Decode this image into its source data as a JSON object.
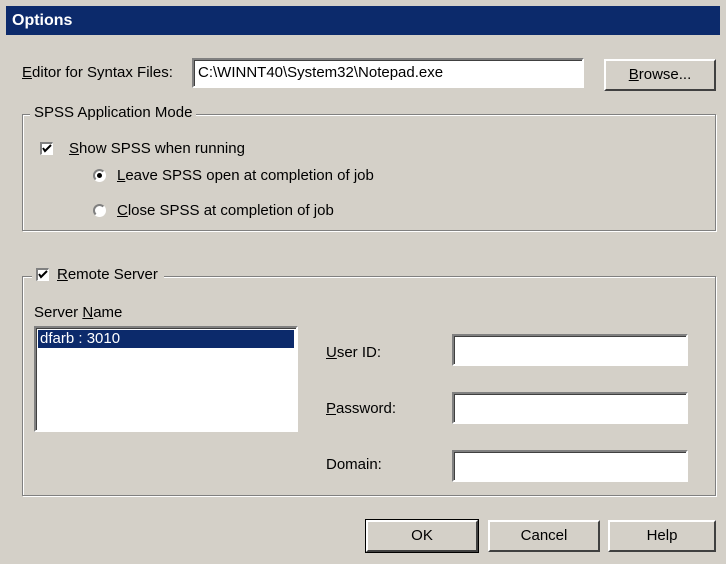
{
  "window": {
    "title": "Options"
  },
  "editor": {
    "label_first": "E",
    "label_rest": "ditor for Syntax Files:",
    "path": "C:\\WINNT40\\System32\\Notepad.exe",
    "browse_first": "B",
    "browse_rest": "rowse..."
  },
  "app_mode": {
    "legend": "SPSS Application Mode",
    "show_first": "S",
    "show_rest": "how SPSS when running",
    "show_checked": true,
    "leave_first": "L",
    "leave_rest": "eave SPSS open at completion of job",
    "leave_selected": true,
    "close_first": "C",
    "close_rest": "lose SPSS at completion of job",
    "close_selected": false
  },
  "remote": {
    "legend_first": "R",
    "legend_rest": "emote Server",
    "enabled": true,
    "server_name_pre": "Server ",
    "server_name_u": "N",
    "server_name_post": "ame",
    "servers": [
      "dfarb : 3010"
    ],
    "userid_first": "U",
    "userid_rest": "ser ID:",
    "password_first": "P",
    "password_rest": "assword:",
    "domain_label": "Domain:",
    "userid_value": "",
    "password_value": "",
    "domain_value": ""
  },
  "buttons": {
    "ok": "OK",
    "cancel": "Cancel",
    "help": "Help"
  }
}
